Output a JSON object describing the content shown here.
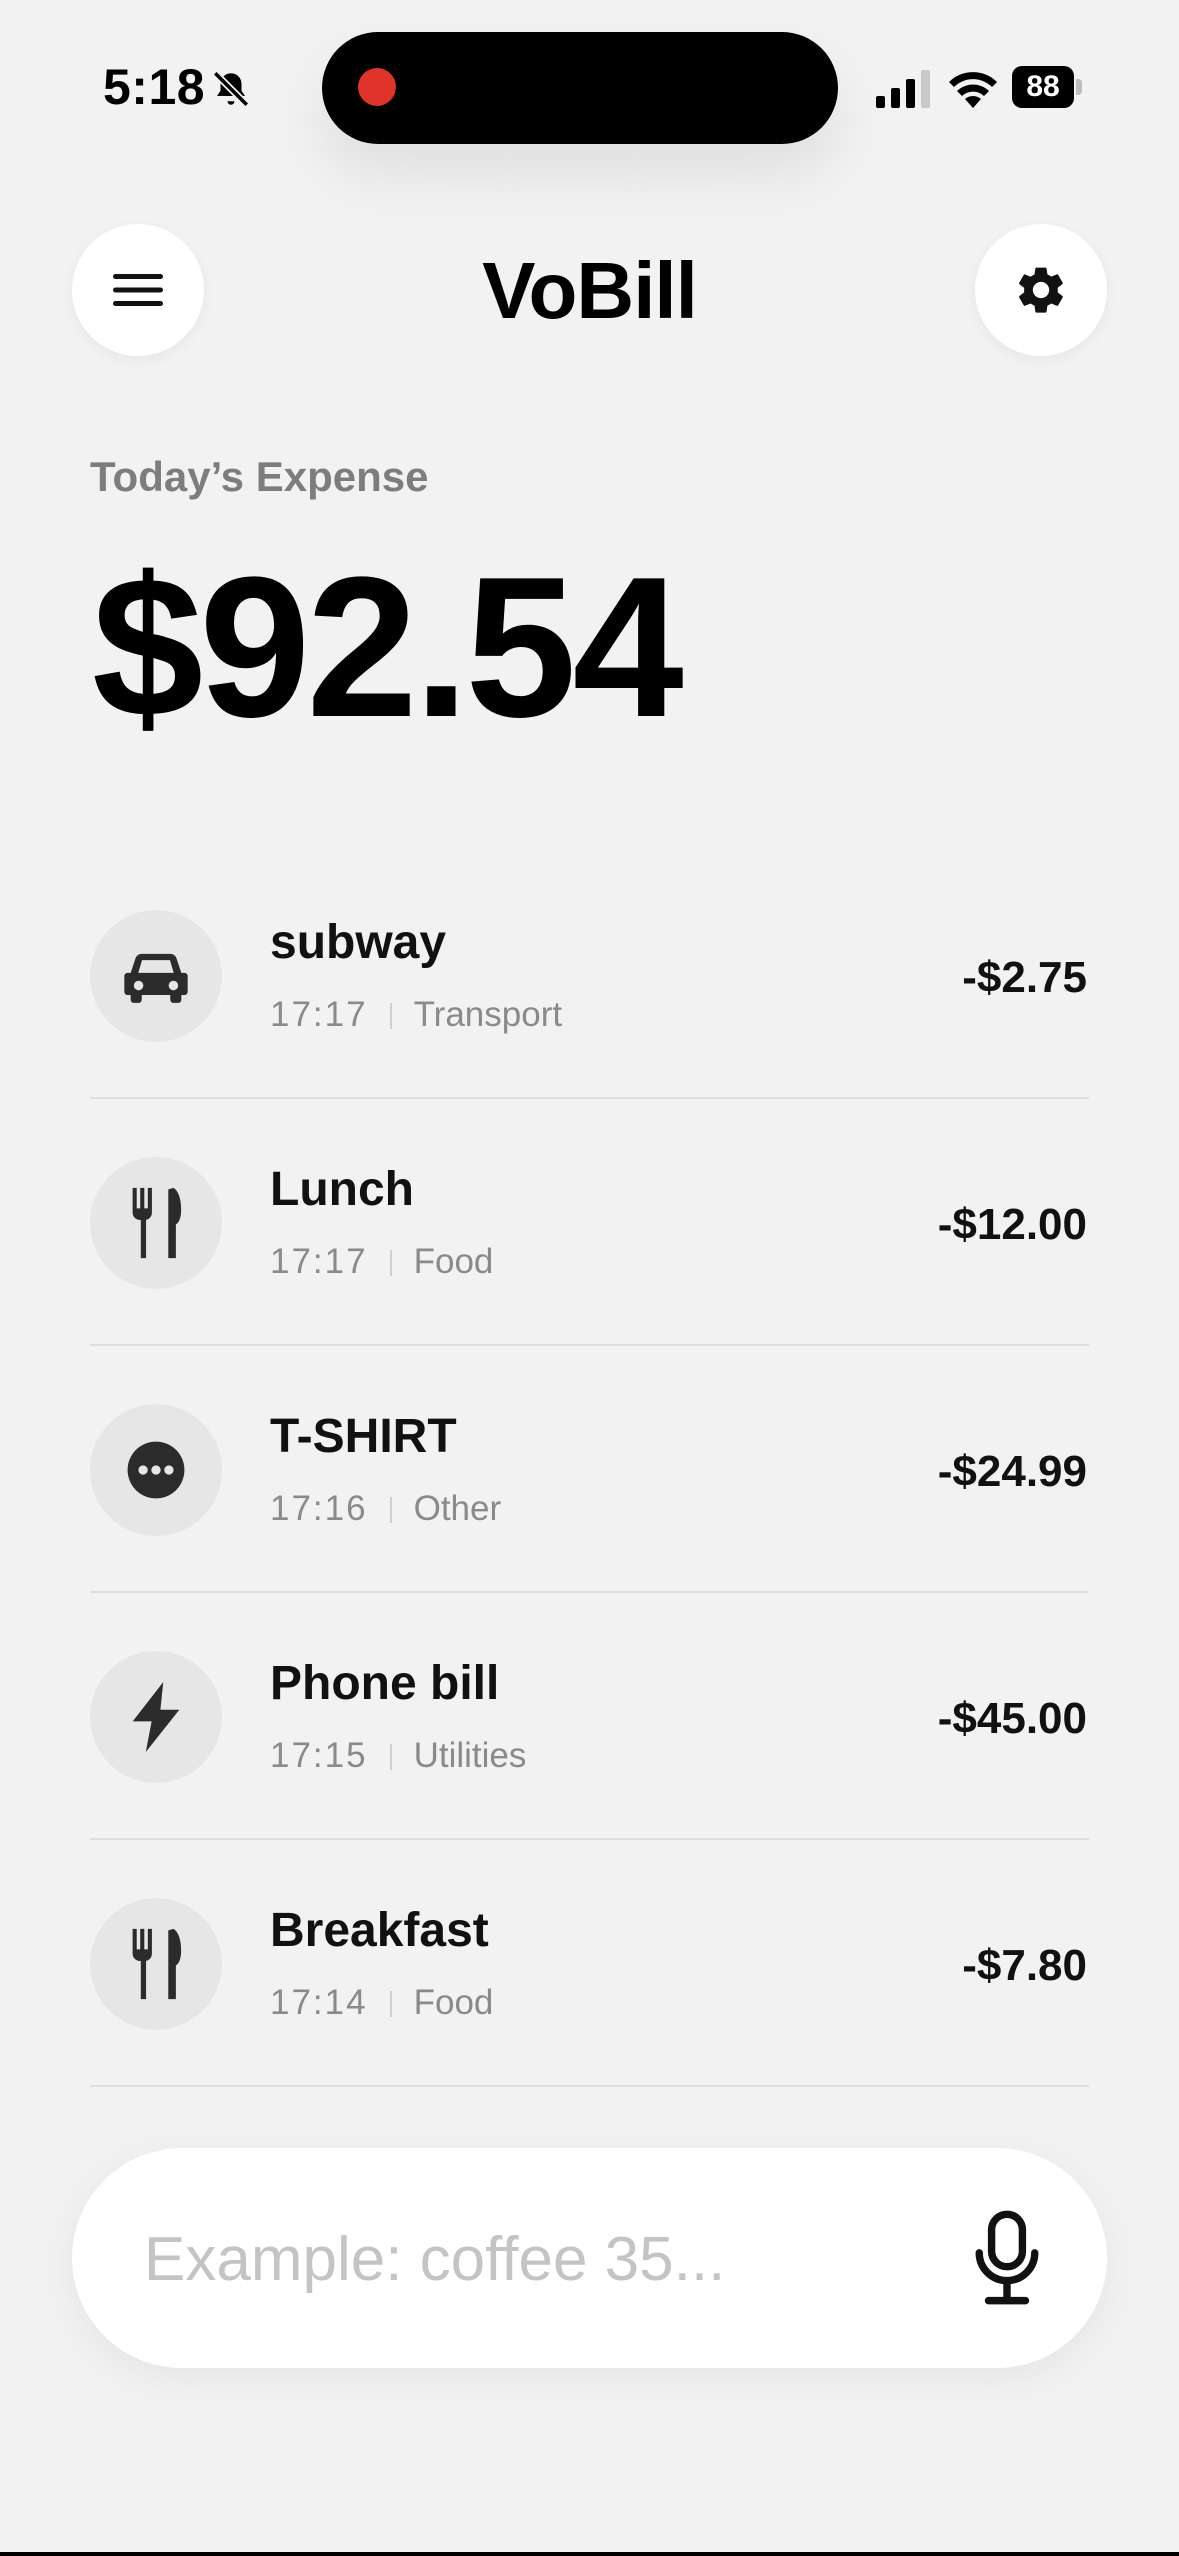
{
  "status_bar": {
    "time": "5:18",
    "battery": "88",
    "icons": [
      "bell-slash-icon",
      "signal-icon",
      "wifi-icon",
      "battery-icon"
    ]
  },
  "header": {
    "title": "VoBill",
    "menu_icon": "hamburger-menu-icon",
    "settings_icon": "gear-icon"
  },
  "summary": {
    "label": "Today’s Expense",
    "amount": "$92.54"
  },
  "expenses": [
    {
      "title": "subway",
      "time": "17:17",
      "category": "Transport",
      "amount": "-$2.75",
      "icon": "car-icon"
    },
    {
      "title": "Lunch",
      "time": "17:17",
      "category": "Food",
      "amount": "-$12.00",
      "icon": "fork-knife-icon"
    },
    {
      "title": "T-SHIRT",
      "time": "17:16",
      "category": "Other",
      "amount": "-$24.99",
      "icon": "more-dots-icon"
    },
    {
      "title": "Phone bill",
      "time": "17:15",
      "category": "Utilities",
      "amount": "-$45.00",
      "icon": "lightning-icon"
    },
    {
      "title": "Breakfast",
      "time": "17:14",
      "category": "Food",
      "amount": "-$7.80",
      "icon": "fork-knife-icon"
    }
  ],
  "input": {
    "placeholder": "Example: coffee 35...",
    "mic_icon": "microphone-icon"
  },
  "colors": {
    "background": "#f2f2f2",
    "text_primary": "#000000",
    "text_secondary": "#8a8a8a",
    "recording_dot": "#e0342a",
    "icon_bg": "#e6e6e6"
  }
}
